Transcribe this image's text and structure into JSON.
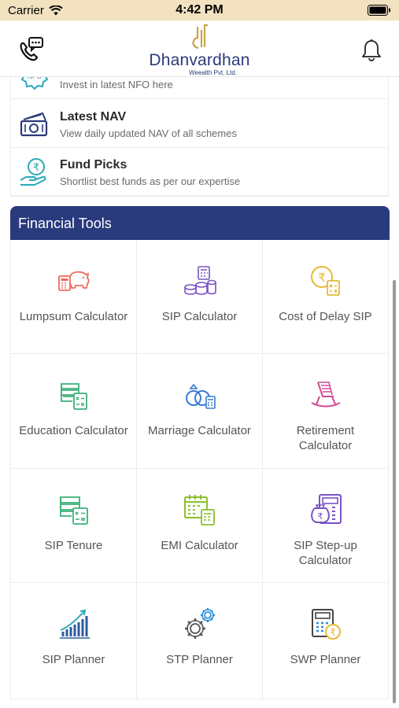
{
  "status_bar": {
    "carrier": "Carrier",
    "time": "4:42 PM"
  },
  "header": {
    "brand_name": "Dhanvardhan",
    "brand_sub": "Weealth Pvt. Ltd.",
    "left_icon": "phone-chat-icon",
    "right_icon": "bell-icon"
  },
  "menu": {
    "items": [
      {
        "title": "",
        "desc": "Invest in latest NFO here",
        "icon": "nfo-icon"
      },
      {
        "title": "Latest NAV",
        "desc": "View daily updated NAV of all schemes",
        "icon": "cash-icon"
      },
      {
        "title": "Fund Picks",
        "desc": "Shortlist best funds as per our expertise",
        "icon": "rupee-hand-icon"
      }
    ]
  },
  "tools": {
    "title": "Financial Tools",
    "items": [
      {
        "label": "Lumpsum Calculator",
        "icon": "piggy-calculator-icon"
      },
      {
        "label": "SIP Calculator",
        "icon": "coins-stack-icon"
      },
      {
        "label": "Cost of Delay SIP",
        "icon": "rupee-coin-calculator-icon"
      },
      {
        "label": "Education Calculator",
        "icon": "book-calculator-icon"
      },
      {
        "label": "Marriage Calculator",
        "icon": "rings-calculator-icon"
      },
      {
        "label": "Retirement Calculator",
        "icon": "rocking-chair-icon"
      },
      {
        "label": "SIP Tenure",
        "icon": "tenure-calculator-icon"
      },
      {
        "label": "EMI Calculator",
        "icon": "calendar-calculator-icon"
      },
      {
        "label": "SIP Step-up Calculator",
        "icon": "money-bag-calculator-icon"
      },
      {
        "label": "SIP Planner",
        "icon": "growth-bars-icon"
      },
      {
        "label": "STP Planner",
        "icon": "gears-icon"
      },
      {
        "label": "SWP Planner",
        "icon": "calculator-rupee-icon"
      }
    ]
  },
  "colors": {
    "status_bar_bg": "#f2e2c0",
    "brand_navy": "#293a7d",
    "brand_gold": "#c9a24b",
    "teal_icon": "#2aa9b8",
    "divider": "#ececec"
  }
}
